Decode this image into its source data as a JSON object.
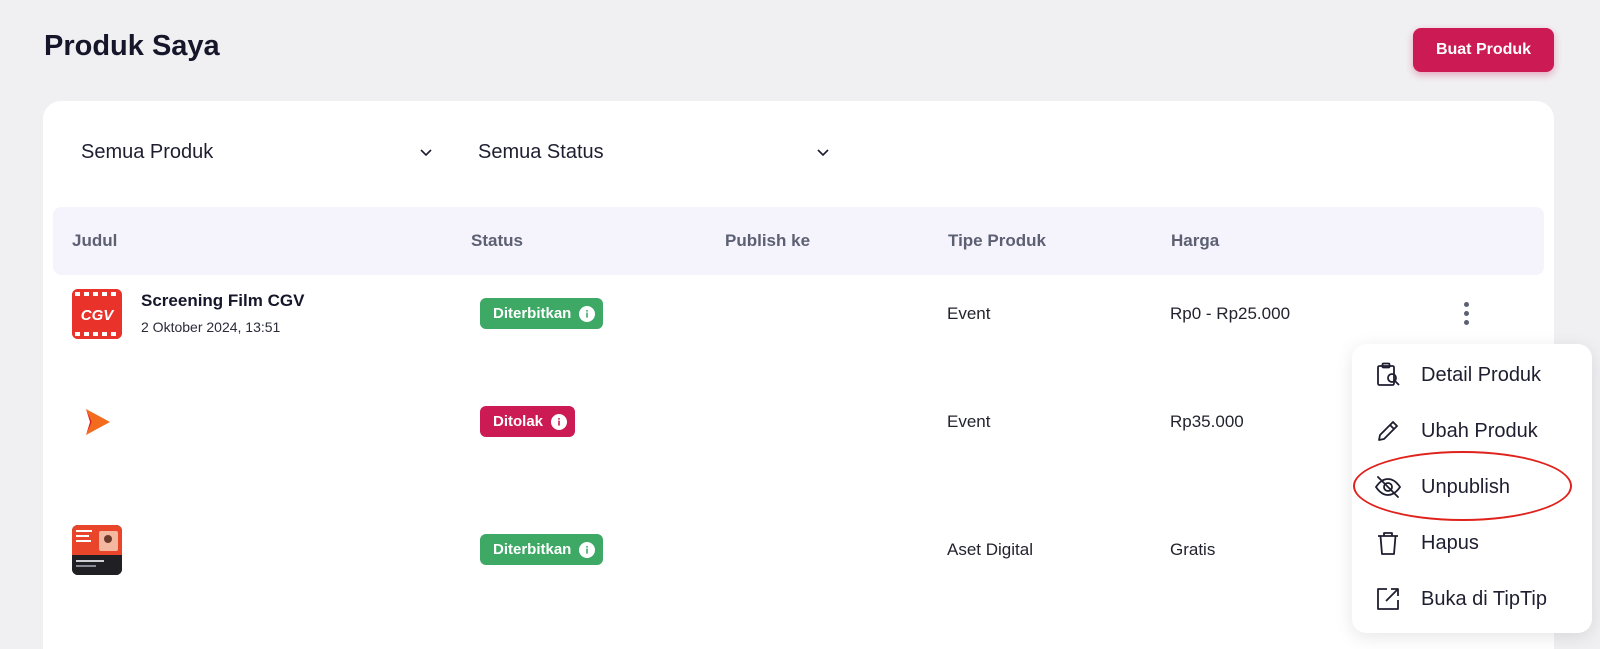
{
  "header": {
    "title": "Produk Saya",
    "create_button": "Buat Produk"
  },
  "filters": {
    "product": "Semua Produk",
    "status": "Semua Status"
  },
  "table": {
    "columns": [
      "Judul",
      "Status",
      "Publish ke",
      "Tipe Produk",
      "Harga"
    ],
    "rows": [
      {
        "thumb_logo": "CGV",
        "title": "Screening Film CGV",
        "date": "2 Oktober 2024, 13:51",
        "status": "Diterbitkan",
        "type": "Event",
        "price": "Rp0 - Rp25.000"
      },
      {
        "title": "",
        "date": "",
        "status": "Ditolak",
        "type": "Event",
        "price": "Rp35.000"
      },
      {
        "title": "",
        "date": "",
        "status": "Diterbitkan",
        "type": "Aset Digital",
        "price": "Gratis"
      }
    ]
  },
  "menu": {
    "items": [
      {
        "label": "Detail Produk",
        "icon": "clipboard-search-icon"
      },
      {
        "label": "Ubah Produk",
        "icon": "pencil-icon"
      },
      {
        "label": "Unpublish",
        "icon": "eye-off-icon"
      },
      {
        "label": "Hapus",
        "icon": "trash-icon"
      },
      {
        "label": "Buka di TipTip",
        "icon": "external-link-icon"
      }
    ]
  },
  "colors": {
    "brand": "#cc1a54",
    "published": "#3ea865",
    "rejected": "#cc1a54",
    "highlight": "#e0221c"
  }
}
